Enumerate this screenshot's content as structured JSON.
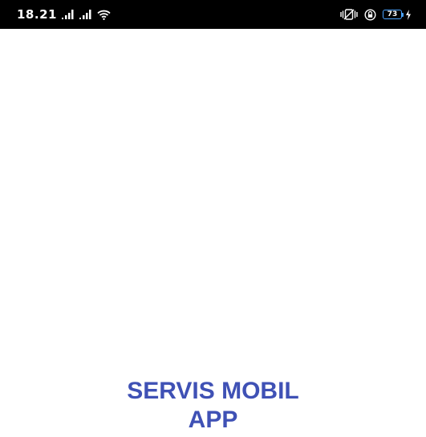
{
  "status_bar": {
    "time": "18.21",
    "battery_level": "73",
    "icons": [
      "signal-icon",
      "signal-icon",
      "wifi-icon",
      "vibrate-icon",
      "rotation-lock-icon",
      "battery-icon",
      "charging-icon"
    ]
  },
  "splash": {
    "title_line1": "SERVIS MOBIL",
    "title_line2": "APP"
  },
  "colors": {
    "title": "#3f51b5",
    "status_bar_bg": "#000000",
    "battery_outline": "#4aa3ff",
    "background": "#ffffff"
  }
}
